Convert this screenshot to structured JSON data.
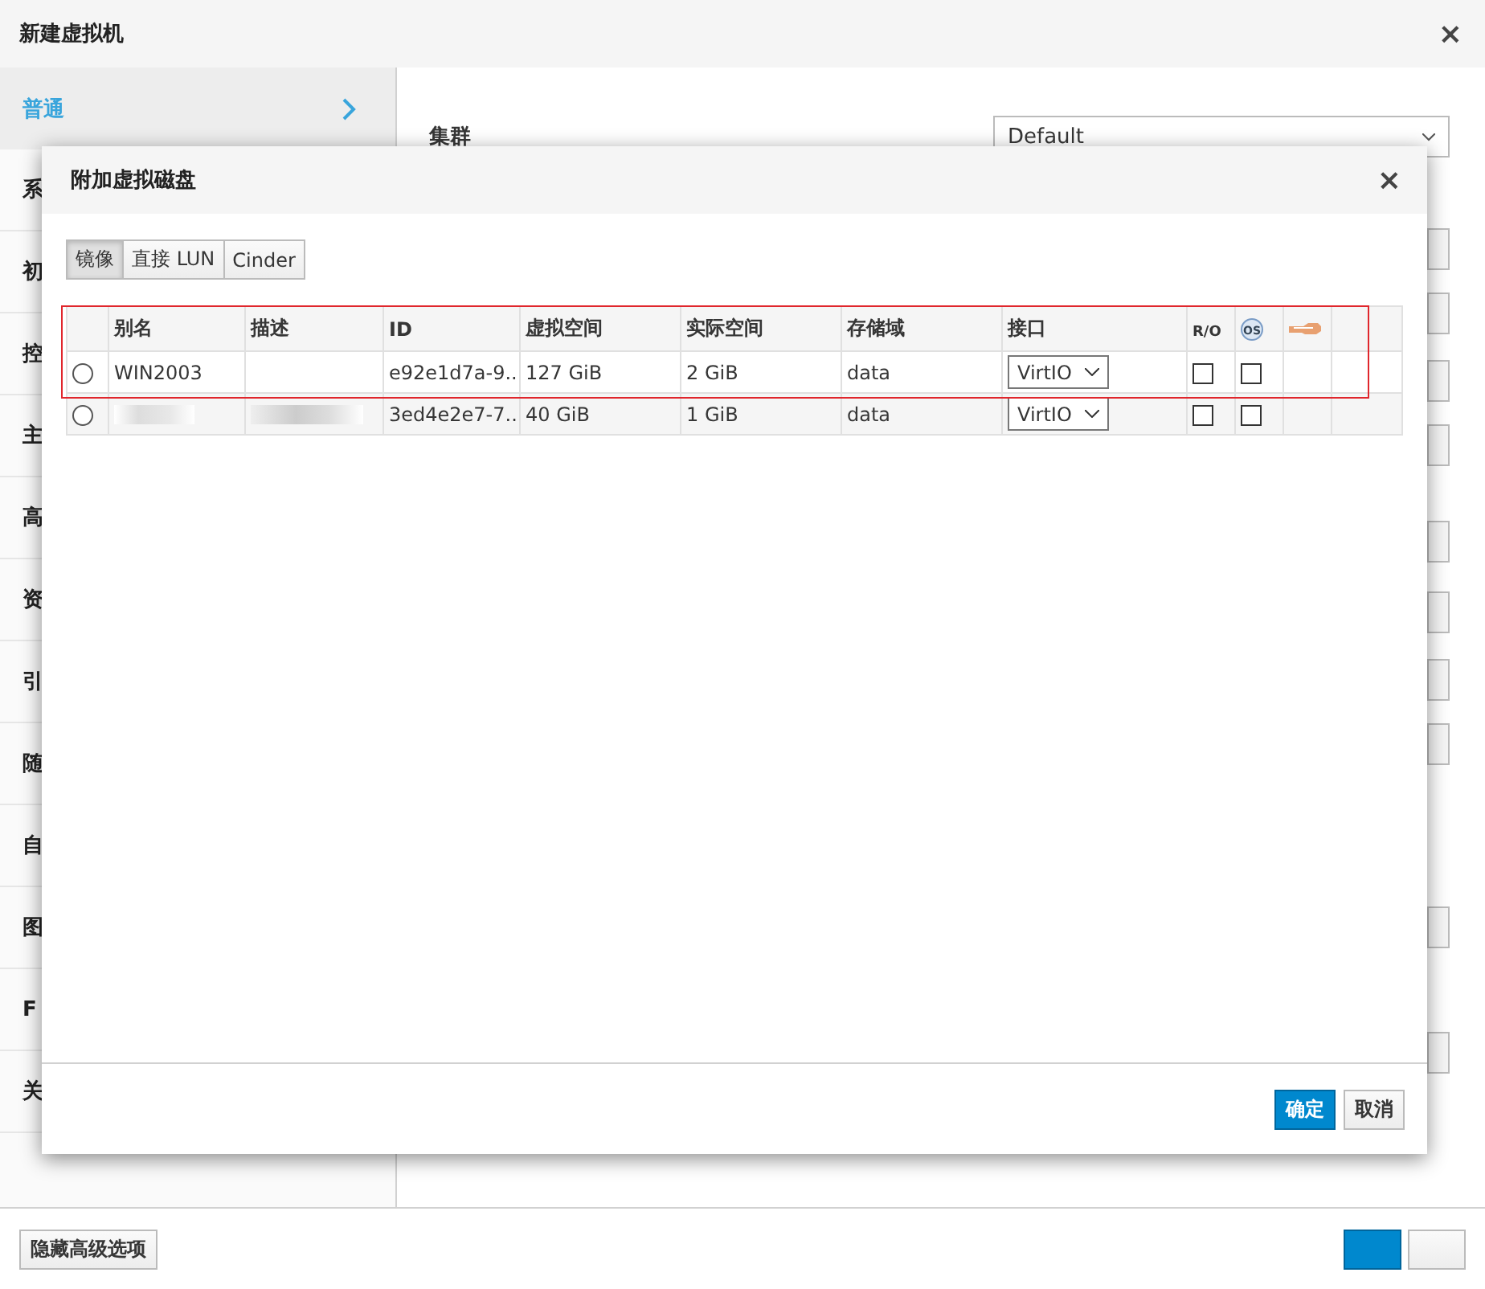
{
  "window": {
    "title": "新建虚拟机",
    "close": "×"
  },
  "sidebar": {
    "items": [
      {
        "label": "普通",
        "selected": true
      },
      {
        "label": "系",
        "selected": false
      },
      {
        "label": "初",
        "selected": false
      },
      {
        "label": "控",
        "selected": false
      },
      {
        "label": "主",
        "selected": false
      },
      {
        "label": "高",
        "selected": false
      },
      {
        "label": "资",
        "selected": false
      },
      {
        "label": "引",
        "selected": false
      },
      {
        "label": "随",
        "selected": false
      },
      {
        "label": "自",
        "selected": false
      },
      {
        "label": "图",
        "selected": false
      },
      {
        "label": "F",
        "selected": false
      },
      {
        "label": "关",
        "selected": false
      }
    ]
  },
  "form": {
    "cluster_label": "集群",
    "cluster_value": "Default"
  },
  "footer": {
    "advanced_button": "隐藏高级选项"
  },
  "dialog": {
    "title": "附加虚拟磁盘",
    "close": "×",
    "tabs": [
      {
        "label": "镜像",
        "selected": true
      },
      {
        "label": "直接 LUN",
        "selected": false
      },
      {
        "label": "Cinder",
        "selected": false
      }
    ],
    "columns": [
      "别名",
      "描述",
      "ID",
      "虚拟空间",
      "实际空间",
      "存储域",
      "接口",
      "R/O",
      "OS"
    ],
    "rows": [
      {
        "selected": false,
        "alias": "WIN2003",
        "id": "e92e1d7a-9...",
        "virtual_size": "127 GiB",
        "actual_size": "2 GiB",
        "domain": "data",
        "interface": "VirtIO",
        "read_only": false,
        "bootable": false,
        "blurred": false
      },
      {
        "selected": false,
        "id": "3ed4e2e7-7...",
        "virtual_size": "40 GiB",
        "actual_size": "1 GiB",
        "domain": "data",
        "interface": "VirtIO",
        "read_only": false,
        "bootable": false,
        "blurred": true
      }
    ],
    "ok_button": "确定",
    "cancel_button": "取消"
  }
}
